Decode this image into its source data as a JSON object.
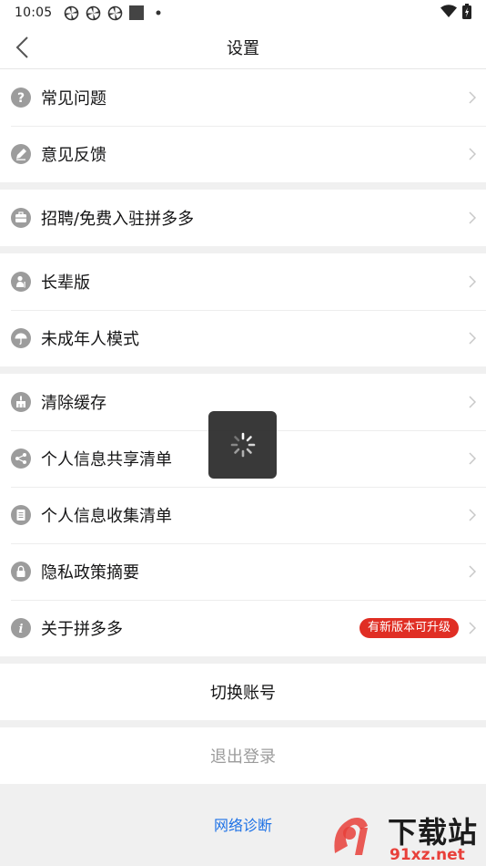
{
  "status_bar": {
    "time": "10:05"
  },
  "nav": {
    "title": "设置"
  },
  "groups": [
    [
      {
        "label": "常见问题",
        "icon": "question-icon"
      },
      {
        "label": "意见反馈",
        "icon": "pencil-icon"
      }
    ],
    [
      {
        "label": "招聘/免费入驻拼多多",
        "icon": "briefcase-icon"
      }
    ],
    [
      {
        "label": "长辈版",
        "icon": "elder-icon"
      },
      {
        "label": "未成年人模式",
        "icon": "umbrella-icon"
      }
    ],
    [
      {
        "label": "清除缓存",
        "icon": "broom-icon"
      },
      {
        "label": "个人信息共享清单",
        "icon": "share-icon"
      },
      {
        "label": "个人信息收集清单",
        "icon": "list-icon"
      },
      {
        "label": "隐私政策摘要",
        "icon": "lock-icon"
      },
      {
        "label": "关于拼多多",
        "icon": "info-icon",
        "badge": "有新版本可升级"
      }
    ]
  ],
  "buttons": {
    "switch_account": "切换账号",
    "logout": "退出登录"
  },
  "footer": {
    "network_diagnosis": "网络诊断"
  },
  "watermark": {
    "text_top": "下载站",
    "text_bottom": "91xz.net"
  },
  "colors": {
    "accent_red": "#e02e24",
    "link_blue": "#1e72e6",
    "icon_gray": "#9c9c9c"
  }
}
